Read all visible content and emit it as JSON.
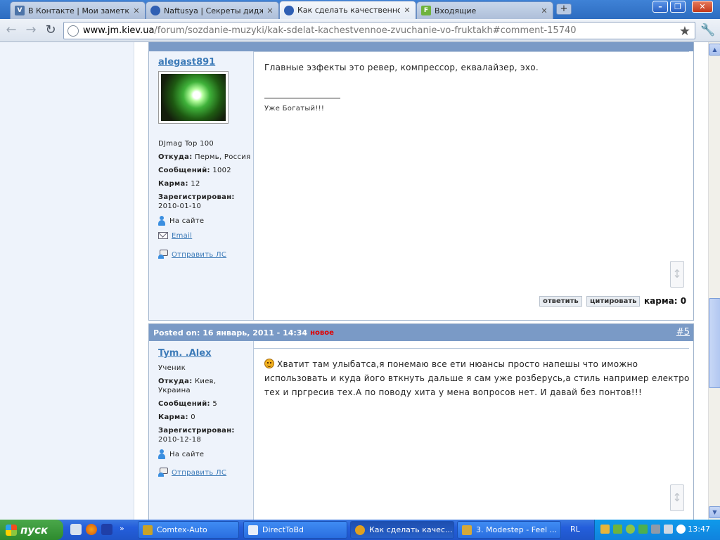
{
  "browser": {
    "tabs": [
      {
        "title": "В Контакте | Мои заметки",
        "favicon_letter": "V",
        "favicon_color": "#4d74a8",
        "active": false
      },
      {
        "title": "Naftusya | Секреты диджея",
        "favicon_letter": "",
        "favicon_color": "#2f5fb3",
        "active": false
      },
      {
        "title": "Как сделать качественное",
        "favicon_letter": "",
        "favicon_color": "#2f5fb3",
        "active": true
      },
      {
        "title": "Входящие",
        "favicon_letter": "F",
        "favicon_color": "#6fb33c",
        "active": false
      }
    ],
    "new_tab_label": "+",
    "window_buttons": {
      "minimize": "–",
      "maximize": "❐",
      "close": "✕"
    },
    "nav": {
      "back": "←",
      "forward": "→",
      "reload": "↻"
    },
    "url": {
      "host": "www.jm.kiev.ua",
      "path": "/forum/sozdanie-muzyki/kak-sdelat-kachestvennoe-zvuchanie-vo-fruktakh#comment-15740"
    },
    "star_icon": "★",
    "wrench_icon": "🔧"
  },
  "posts": [
    {
      "author": "alegast891",
      "rank": "DJmag Top 100",
      "from_label": "Откуда:",
      "from_value": "Пермь, Россия",
      "messages_label": "Сообщений:",
      "messages_value": "1002",
      "karma_label": "Карма:",
      "karma_value": "12",
      "registered_label": "Зарегистрирован:",
      "registered_value": "2010-01-10",
      "status": "На сайте",
      "email_link": "Email",
      "pm_link": "Отправить ЛС",
      "message": "Главные эзфекты это ревер, компрессор, еквалайзер, эхо.",
      "signature": "Уже Богатый!!!",
      "reply_button": "ответить",
      "quote_button": "цитировать",
      "karma_footer": "карма: 0"
    },
    {
      "header": "Posted on: 16 январь, 2011 - 14:34",
      "new_badge": "новое",
      "number": "#5",
      "author": "Tym.  .Alex",
      "rank": "Ученик",
      "from_label": "Откуда:",
      "from_value_1": "Киев,",
      "from_value_2": "Украина",
      "messages_label": "Сообщений:",
      "messages_value": "5",
      "karma_label": "Карма:",
      "karma_value": "0",
      "registered_label": "Зарегистрирован:",
      "registered_value": "2010-12-18",
      "status": "На сайте",
      "pm_link": "Отправить ЛС",
      "message_line_1": "Хватит там улыбатса,я понемаю все ети нюансы просто напешы что иможно",
      "message_line_2": "использовать и куда його вткнуть дальше я сам уже розберусь,а стиль например електро",
      "message_line_3": "тех и пргресив тех.А по поводу хита у мена вопросов нет. И давай без понтов!!!"
    }
  ],
  "scrollbar": {
    "up": "▲",
    "down": "▼"
  },
  "taskbar": {
    "start_label": "пуск",
    "items": [
      {
        "label": "Comtex-Auto",
        "icon_color": "#c9a227",
        "active": false
      },
      {
        "label": "DirectToBd",
        "icon_color": "#e7eef9",
        "active": false
      },
      {
        "label": "Как сделать качес...",
        "icon_color": "#e0a020",
        "active": true
      },
      {
        "label": "3. Modestep - Feel ...",
        "icon_color": "#d4a83a",
        "active": false
      }
    ],
    "language": "RL",
    "clock": "13:47"
  }
}
